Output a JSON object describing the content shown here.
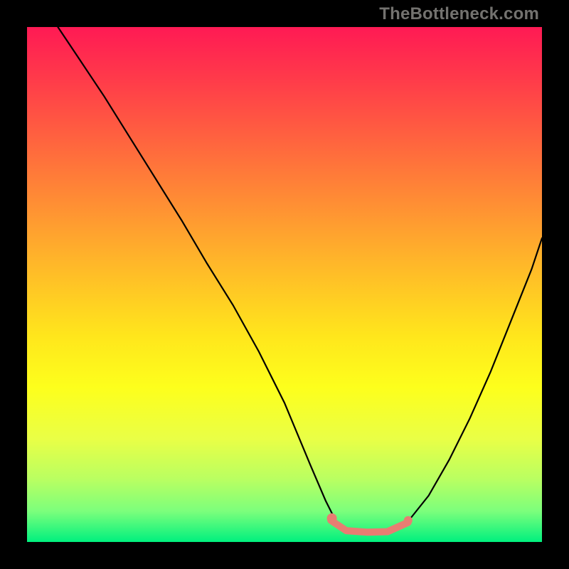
{
  "watermark": "TheBottleneck.com",
  "chart_data": {
    "type": "line",
    "title": "",
    "xlabel": "",
    "ylabel": "",
    "xlim": [
      0,
      100
    ],
    "ylim": [
      0,
      100
    ],
    "series": [
      {
        "name": "curve-left",
        "x": [
          6,
          10,
          15,
          20,
          25,
          30,
          35,
          40,
          45,
          50,
          55,
          58,
          60
        ],
        "values": [
          100,
          94,
          86.5,
          78.5,
          70.5,
          62.5,
          54,
          46,
          37,
          27,
          15,
          8,
          4
        ]
      },
      {
        "name": "curve-right",
        "x": [
          74,
          78,
          82,
          86,
          90,
          94,
          98,
          100
        ],
        "values": [
          4,
          9,
          16,
          24,
          33,
          43,
          53,
          59
        ]
      },
      {
        "name": "valley-band",
        "x": [
          59,
          62,
          66,
          70,
          74
        ],
        "values": [
          4.2,
          2.2,
          1.9,
          2.0,
          3.8
        ]
      }
    ],
    "annotations": [
      {
        "name": "left-dot",
        "x": 59.2,
        "y": 4.6
      },
      {
        "name": "right-dot",
        "x": 74.0,
        "y": 4.2
      }
    ],
    "colors": {
      "curve": "#000000",
      "accent": "#e87d72",
      "gradient_top": "#ff1a54",
      "gradient_bottom": "#00f07e"
    }
  }
}
